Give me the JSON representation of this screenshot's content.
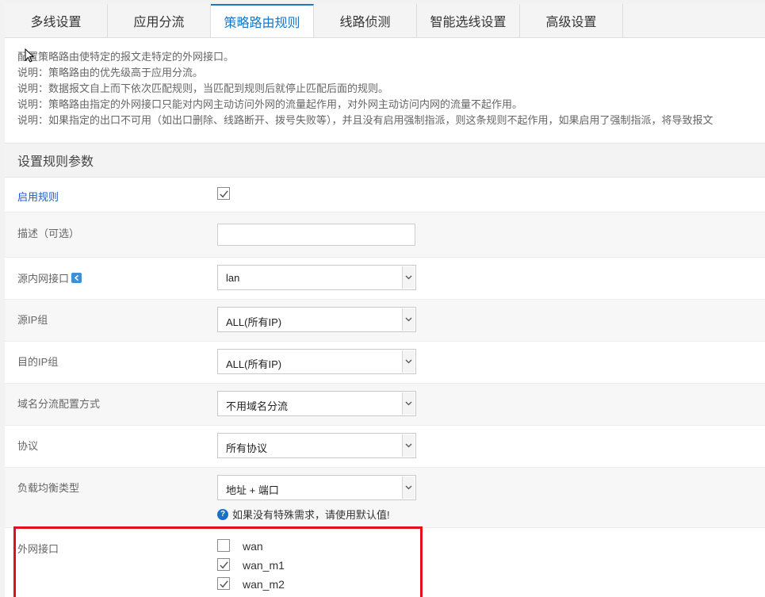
{
  "tabs": [
    {
      "label": "多线设置"
    },
    {
      "label": "应用分流"
    },
    {
      "label": "策略路由规则"
    },
    {
      "label": "线路侦测"
    },
    {
      "label": "智能选线设置"
    },
    {
      "label": "高级设置"
    }
  ],
  "notes": [
    "配置策略路由使特定的报文走特定的外网接口。",
    "说明：策略路由的优先级高于应用分流。",
    "说明：数据报文自上而下依次匹配规则，当匹配到规则后就停止匹配后面的规则。",
    "说明：策略路由指定的外网接口只能对内网主动访问外网的流量起作用，对外网主动访问内网的流量不起作用。",
    "说明：如果指定的出口不可用（如出口删除、线路断开、拨号失败等），并且没有启用强制指派，则这条规则不起作用，如果启用了强制指派，将导致报文"
  ],
  "section_title": "设置规则参数",
  "form": {
    "enable_label": "启用规则",
    "enable_checked": true,
    "desc_label": "描述（可选）",
    "desc_value": "",
    "src_iface_label": "源内网接口",
    "src_iface_value": "lan",
    "src_ip_label": "源IP组",
    "src_ip_value": "ALL(所有IP)",
    "dst_ip_label": "目的IP组",
    "dst_ip_value": "ALL(所有IP)",
    "domain_label": "域名分流配置方式",
    "domain_value": "不用域名分流",
    "proto_label": "协议",
    "proto_value": "所有协议",
    "lb_label": "负载均衡类型",
    "lb_value": "地址 + 端口",
    "lb_hint": "如果没有特殊需求，请使用默认值!",
    "wan_label": "外网接口",
    "wans": [
      {
        "name": "wan",
        "checked": false
      },
      {
        "name": "wan_m1",
        "checked": true
      },
      {
        "name": "wan_m2",
        "checked": true
      }
    ]
  },
  "icons": {
    "back_icon": "arrow-left-icon",
    "hint_icon": "question-icon",
    "dropdown_icon": "chevron-down-icon",
    "check_icon": "checkmark-icon",
    "cursor_icon": "mouse-pointer-icon"
  },
  "colors": {
    "accent": "#1a78c8",
    "highlight_box": "#e0101e"
  }
}
